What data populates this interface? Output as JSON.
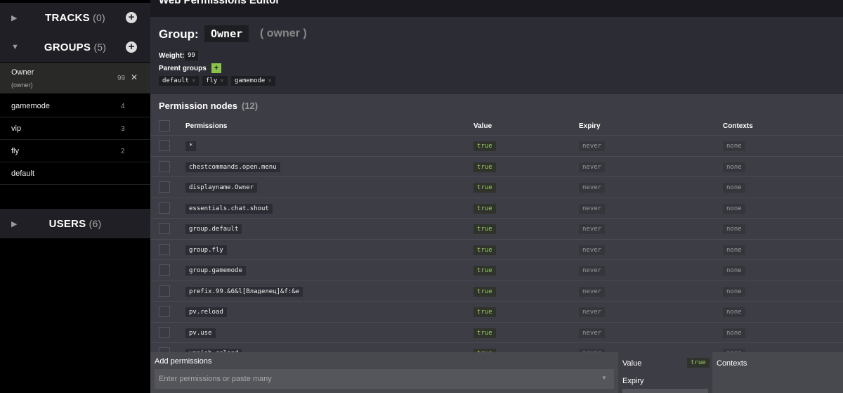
{
  "sidebar": {
    "tracks": {
      "label": "TRACKS",
      "count": "(0)"
    },
    "groups": {
      "label": "GROUPS",
      "count": "(5)"
    },
    "users": {
      "label": "USERS",
      "count": "(6)"
    },
    "group_items": [
      {
        "name": "Owner",
        "sub": "(owner)",
        "weight": "99"
      },
      {
        "name": "gamemode",
        "weight": "4"
      },
      {
        "name": "vip",
        "weight": "3"
      },
      {
        "name": "fly",
        "weight": "2"
      },
      {
        "name": "default",
        "weight": ""
      }
    ]
  },
  "header": {
    "title": "Web Permissions Editor"
  },
  "group": {
    "label": "Group:",
    "name": "Owner",
    "id": "( owner )",
    "weight_label": "Weight:",
    "weight": "99",
    "parent_label": "Parent groups",
    "parents": [
      "default",
      "fly",
      "gamemode"
    ]
  },
  "permissions": {
    "title": "Permission nodes",
    "count": "(12)",
    "columns": {
      "perm": "Permissions",
      "value": "Value",
      "expiry": "Expiry",
      "contexts": "Contexts"
    },
    "rows": [
      {
        "perm": "*",
        "value": "true",
        "expiry": "never",
        "contexts": "none"
      },
      {
        "perm": "chestcommands.open.menu",
        "value": "true",
        "expiry": "never",
        "contexts": "none"
      },
      {
        "perm": "displayname.Owner",
        "value": "true",
        "expiry": "never",
        "contexts": "none"
      },
      {
        "perm": "essentials.chat.shout",
        "value": "true",
        "expiry": "never",
        "contexts": "none"
      },
      {
        "perm": "group.default",
        "value": "true",
        "expiry": "never",
        "contexts": "none"
      },
      {
        "perm": "group.fly",
        "value": "true",
        "expiry": "never",
        "contexts": "none"
      },
      {
        "perm": "group.gamemode",
        "value": "true",
        "expiry": "never",
        "contexts": "none"
      },
      {
        "perm": "prefix.99.&6&l[Владелец]&f:&e",
        "value": "true",
        "expiry": "never",
        "contexts": "none"
      },
      {
        "perm": "pv.reload",
        "value": "true",
        "expiry": "never",
        "contexts": "none"
      },
      {
        "perm": "pv.use",
        "value": "true",
        "expiry": "never",
        "contexts": "none"
      },
      {
        "perm": "vanish.reload",
        "value": "true",
        "expiry": "never",
        "contexts": "none"
      }
    ]
  },
  "add": {
    "label": "Add permissions",
    "placeholder": "Enter permissions or paste many",
    "value_label": "Value",
    "value": "true",
    "expiry_label": "Expiry",
    "contexts_label": "Contexts"
  },
  "colors": {
    "accent": "#8bc34a",
    "true_text": "#9ccc65"
  }
}
